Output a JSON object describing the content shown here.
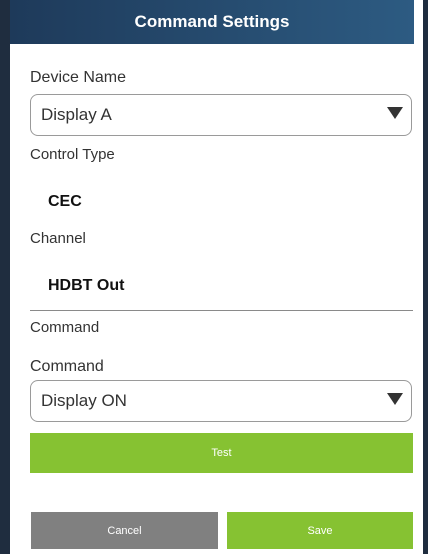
{
  "header": {
    "title": "Command Settings"
  },
  "device_name": {
    "label": "Device Name",
    "selected": "Display A"
  },
  "control_type": {
    "label": "Control Type",
    "value": "CEC"
  },
  "channel": {
    "label": "Channel",
    "value": "HDBT Out"
  },
  "command_section": {
    "label": "Command"
  },
  "command": {
    "label": "Command",
    "selected": "Display ON"
  },
  "buttons": {
    "test": "Test",
    "cancel": "Cancel",
    "save": "Save"
  },
  "colors": {
    "header": "#2d5b82",
    "primary": "#86c232",
    "secondary": "#808080"
  }
}
